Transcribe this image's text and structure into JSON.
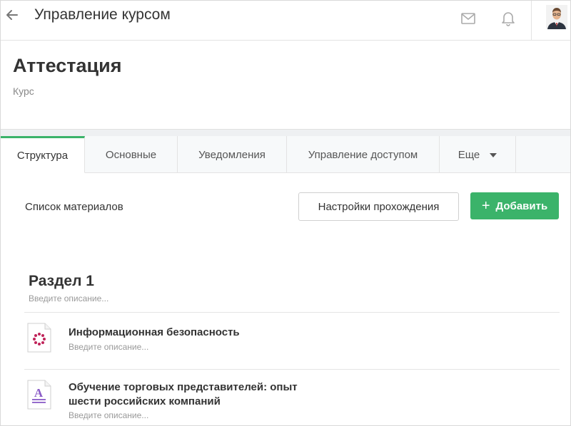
{
  "topbar": {
    "title": "Управление курсом",
    "icons": [
      "arrow-left-icon",
      "mail-icon",
      "bell-icon",
      "avatar"
    ]
  },
  "course": {
    "title": "Аттестация",
    "subtitle": "Курс"
  },
  "tabs": [
    {
      "label": "Структура",
      "active": true
    },
    {
      "label": "Основные",
      "active": false
    },
    {
      "label": "Уведомления",
      "active": false
    },
    {
      "label": "Управление доступом",
      "active": false
    },
    {
      "label": "Еще",
      "active": false
    }
  ],
  "toolbar": {
    "materials_label": "Список материалов",
    "settings_label": "Настройки прохождения",
    "add_label": "Добавить"
  },
  "section": {
    "title": "Раздел 1",
    "description_placeholder": "Введите описание..."
  },
  "items": [
    {
      "icon": "presentation-icon",
      "title": "Информационная безопасность",
      "description_placeholder": "Введите описание..."
    },
    {
      "icon": "text-document-icon",
      "title_line1": "Обучение торговых представителей: опыт",
      "title_line2": "шести российских компаний",
      "description_placeholder": "Введите описание..."
    }
  ],
  "colors": {
    "accent": "#3bb36a",
    "icon_red": "#c0245a",
    "icon_purple": "#8a5cc7"
  }
}
